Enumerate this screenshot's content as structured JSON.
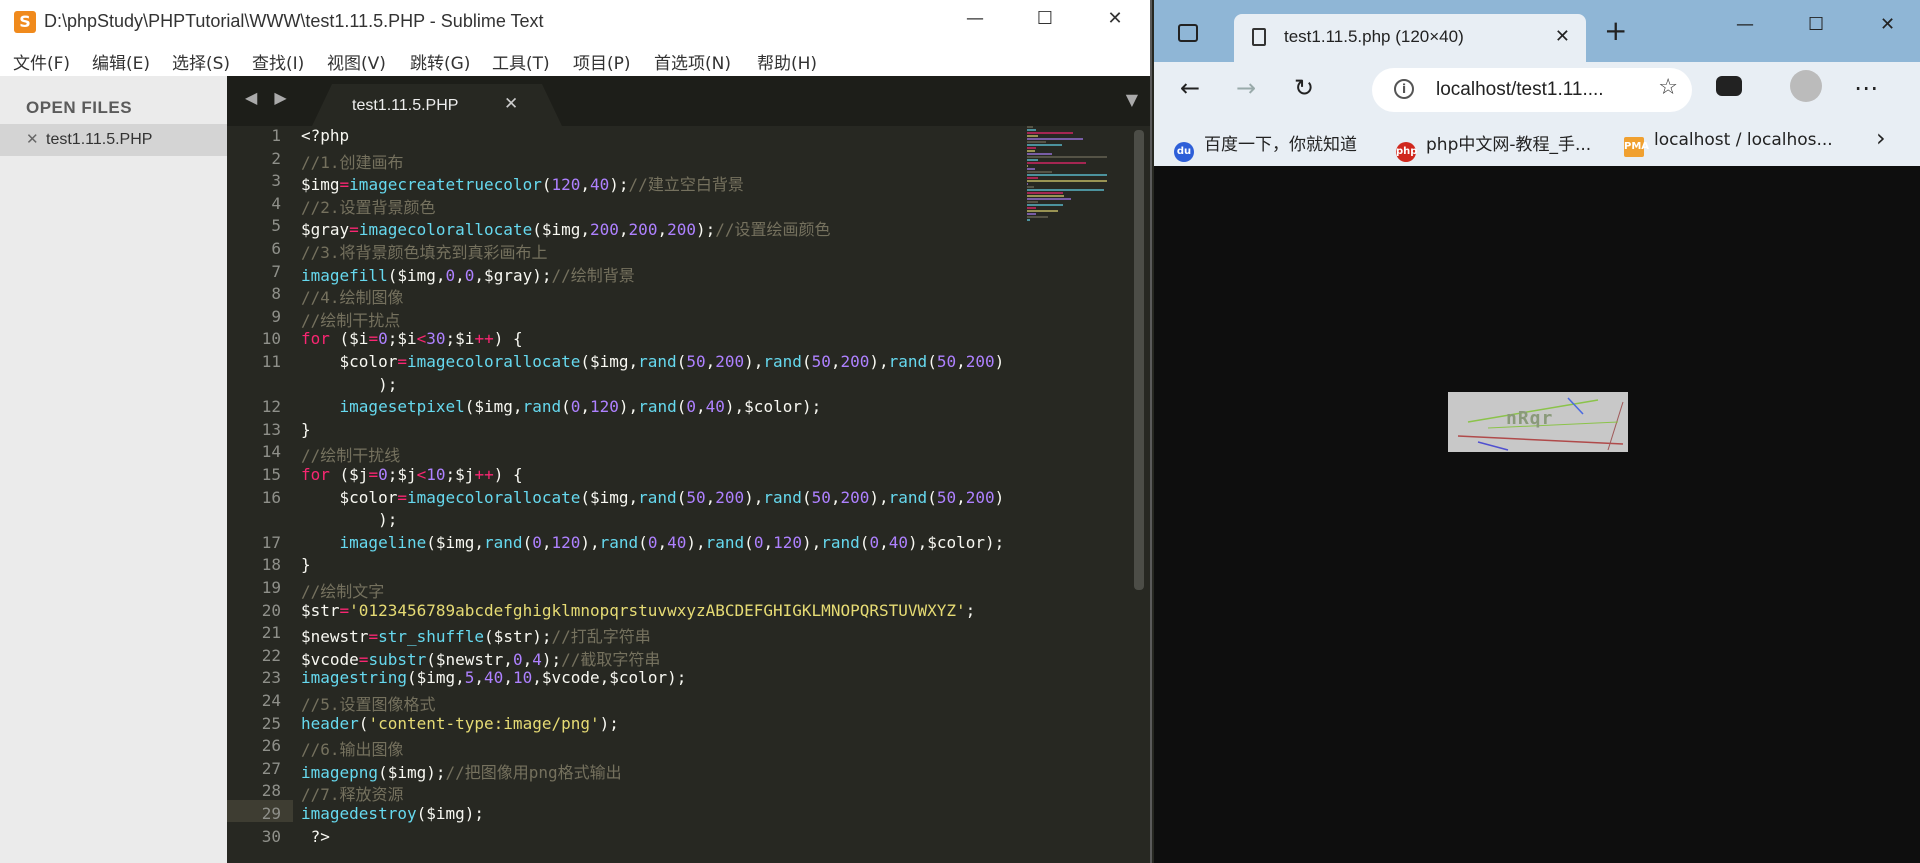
{
  "editor": {
    "title": "D:\\phpStudy\\PHPTutorial\\WWW\\test1.11.5.PHP - Sublime Text",
    "logo_letter": "S",
    "window_buttons": {
      "minimize": "—",
      "maximize": "☐",
      "close": "✕"
    },
    "menu": [
      "文件(F)",
      "编辑(E)",
      "选择(S)",
      "查找(I)",
      "视图(V)",
      "跳转(G)",
      "工具(T)",
      "项目(P)",
      "首选项(N)",
      "帮助(H)"
    ],
    "sidebar": {
      "header": "OPEN FILES",
      "file_close": "✕",
      "file": "test1.11.5.PHP"
    },
    "tab": {
      "arrows": "◀ ▶",
      "name": "test1.11.5.PHP",
      "close": "✕",
      "dropdown": "▼"
    },
    "line_numbers": [
      "1",
      "2",
      "3",
      "4",
      "5",
      "6",
      "7",
      "8",
      "9",
      "10",
      "11",
      "",
      "12",
      "13",
      "14",
      "15",
      "16",
      "",
      "17",
      "18",
      "19",
      "20",
      "21",
      "22",
      "23",
      "24",
      "25",
      "26",
      "27",
      "28",
      "29",
      "30"
    ],
    "code_lines": [
      [
        {
          "t": "<?php",
          "c": ""
        }
      ],
      [
        {
          "t": "//1.创建画布",
          "c": "cm"
        }
      ],
      [
        {
          "t": "$img",
          "c": ""
        },
        {
          "t": "=",
          "c": "op"
        },
        {
          "t": "imagecreatetruecolor",
          "c": "fn"
        },
        {
          "t": "(",
          "c": ""
        },
        {
          "t": "120",
          "c": "num"
        },
        {
          "t": ",",
          "c": ""
        },
        {
          "t": "40",
          "c": "num"
        },
        {
          "t": ");",
          "c": ""
        },
        {
          "t": "//建立空白背景",
          "c": "cm"
        }
      ],
      [
        {
          "t": "//2.设置背景颜色",
          "c": "cm"
        }
      ],
      [
        {
          "t": "$gray",
          "c": ""
        },
        {
          "t": "=",
          "c": "op"
        },
        {
          "t": "imagecolorallocate",
          "c": "fn"
        },
        {
          "t": "($img,",
          "c": ""
        },
        {
          "t": "200",
          "c": "num"
        },
        {
          "t": ",",
          "c": ""
        },
        {
          "t": "200",
          "c": "num"
        },
        {
          "t": ",",
          "c": ""
        },
        {
          "t": "200",
          "c": "num"
        },
        {
          "t": ");",
          "c": ""
        },
        {
          "t": "//设置绘画颜色",
          "c": "cm"
        }
      ],
      [
        {
          "t": "//3.将背景颜色填充到真彩画布上",
          "c": "cm"
        }
      ],
      [
        {
          "t": "imagefill",
          "c": "fn"
        },
        {
          "t": "($img,",
          "c": ""
        },
        {
          "t": "0",
          "c": "num"
        },
        {
          "t": ",",
          "c": ""
        },
        {
          "t": "0",
          "c": "num"
        },
        {
          "t": ",$gray);",
          "c": ""
        },
        {
          "t": "//绘制背景",
          "c": "cm"
        }
      ],
      [
        {
          "t": "//4.绘制图像",
          "c": "cm"
        }
      ],
      [
        {
          "t": "//绘制干扰点",
          "c": "cm"
        }
      ],
      [
        {
          "t": "for",
          "c": "kw"
        },
        {
          "t": " ($i",
          "c": ""
        },
        {
          "t": "=",
          "c": "op"
        },
        {
          "t": "0",
          "c": "num"
        },
        {
          "t": ";$i",
          "c": ""
        },
        {
          "t": "<",
          "c": "op"
        },
        {
          "t": "30",
          "c": "num"
        },
        {
          "t": ";$i",
          "c": ""
        },
        {
          "t": "++",
          "c": "op"
        },
        {
          "t": ") {",
          "c": ""
        }
      ],
      [
        {
          "t": "    $color",
          "c": ""
        },
        {
          "t": "=",
          "c": "op"
        },
        {
          "t": "imagecolorallocate",
          "c": "fn"
        },
        {
          "t": "($img,",
          "c": ""
        },
        {
          "t": "rand",
          "c": "fn"
        },
        {
          "t": "(",
          "c": ""
        },
        {
          "t": "50",
          "c": "num"
        },
        {
          "t": ",",
          "c": ""
        },
        {
          "t": "200",
          "c": "num"
        },
        {
          "t": "),",
          "c": ""
        },
        {
          "t": "rand",
          "c": "fn"
        },
        {
          "t": "(",
          "c": ""
        },
        {
          "t": "50",
          "c": "num"
        },
        {
          "t": ",",
          "c": ""
        },
        {
          "t": "200",
          "c": "num"
        },
        {
          "t": "),",
          "c": ""
        },
        {
          "t": "rand",
          "c": "fn"
        },
        {
          "t": "(",
          "c": ""
        },
        {
          "t": "50",
          "c": "num"
        },
        {
          "t": ",",
          "c": ""
        },
        {
          "t": "200",
          "c": "num"
        },
        {
          "t": ")",
          "c": ""
        }
      ],
      [
        {
          "t": "        );",
          "c": ""
        }
      ],
      [
        {
          "t": "    ",
          "c": ""
        },
        {
          "t": "imagesetpixel",
          "c": "fn"
        },
        {
          "t": "($img,",
          "c": ""
        },
        {
          "t": "rand",
          "c": "fn"
        },
        {
          "t": "(",
          "c": ""
        },
        {
          "t": "0",
          "c": "num"
        },
        {
          "t": ",",
          "c": ""
        },
        {
          "t": "120",
          "c": "num"
        },
        {
          "t": "),",
          "c": ""
        },
        {
          "t": "rand",
          "c": "fn"
        },
        {
          "t": "(",
          "c": ""
        },
        {
          "t": "0",
          "c": "num"
        },
        {
          "t": ",",
          "c": ""
        },
        {
          "t": "40",
          "c": "num"
        },
        {
          "t": "),$color);",
          "c": ""
        }
      ],
      [
        {
          "t": "}",
          "c": ""
        }
      ],
      [
        {
          "t": "//绘制干扰线",
          "c": "cm"
        }
      ],
      [
        {
          "t": "for",
          "c": "kw"
        },
        {
          "t": " ($j",
          "c": ""
        },
        {
          "t": "=",
          "c": "op"
        },
        {
          "t": "0",
          "c": "num"
        },
        {
          "t": ";$j",
          "c": ""
        },
        {
          "t": "<",
          "c": "op"
        },
        {
          "t": "10",
          "c": "num"
        },
        {
          "t": ";$j",
          "c": ""
        },
        {
          "t": "++",
          "c": "op"
        },
        {
          "t": ") {",
          "c": ""
        }
      ],
      [
        {
          "t": "    $color",
          "c": ""
        },
        {
          "t": "=",
          "c": "op"
        },
        {
          "t": "imagecolorallocate",
          "c": "fn"
        },
        {
          "t": "($img,",
          "c": ""
        },
        {
          "t": "rand",
          "c": "fn"
        },
        {
          "t": "(",
          "c": ""
        },
        {
          "t": "50",
          "c": "num"
        },
        {
          "t": ",",
          "c": ""
        },
        {
          "t": "200",
          "c": "num"
        },
        {
          "t": "),",
          "c": ""
        },
        {
          "t": "rand",
          "c": "fn"
        },
        {
          "t": "(",
          "c": ""
        },
        {
          "t": "50",
          "c": "num"
        },
        {
          "t": ",",
          "c": ""
        },
        {
          "t": "200",
          "c": "num"
        },
        {
          "t": "),",
          "c": ""
        },
        {
          "t": "rand",
          "c": "fn"
        },
        {
          "t": "(",
          "c": ""
        },
        {
          "t": "50",
          "c": "num"
        },
        {
          "t": ",",
          "c": ""
        },
        {
          "t": "200",
          "c": "num"
        },
        {
          "t": ")",
          "c": ""
        }
      ],
      [
        {
          "t": "        );",
          "c": ""
        }
      ],
      [
        {
          "t": "    ",
          "c": ""
        },
        {
          "t": "imageline",
          "c": "fn"
        },
        {
          "t": "($img,",
          "c": ""
        },
        {
          "t": "rand",
          "c": "fn"
        },
        {
          "t": "(",
          "c": ""
        },
        {
          "t": "0",
          "c": "num"
        },
        {
          "t": ",",
          "c": ""
        },
        {
          "t": "120",
          "c": "num"
        },
        {
          "t": "),",
          "c": ""
        },
        {
          "t": "rand",
          "c": "fn"
        },
        {
          "t": "(",
          "c": ""
        },
        {
          "t": "0",
          "c": "num"
        },
        {
          "t": ",",
          "c": ""
        },
        {
          "t": "40",
          "c": "num"
        },
        {
          "t": "),",
          "c": ""
        },
        {
          "t": "rand",
          "c": "fn"
        },
        {
          "t": "(",
          "c": ""
        },
        {
          "t": "0",
          "c": "num"
        },
        {
          "t": ",",
          "c": ""
        },
        {
          "t": "120",
          "c": "num"
        },
        {
          "t": "),",
          "c": ""
        },
        {
          "t": "rand",
          "c": "fn"
        },
        {
          "t": "(",
          "c": ""
        },
        {
          "t": "0",
          "c": "num"
        },
        {
          "t": ",",
          "c": ""
        },
        {
          "t": "40",
          "c": "num"
        },
        {
          "t": "),$color);",
          "c": ""
        }
      ],
      [
        {
          "t": "}",
          "c": ""
        }
      ],
      [
        {
          "t": "//绘制文字",
          "c": "cm"
        }
      ],
      [
        {
          "t": "$str",
          "c": ""
        },
        {
          "t": "=",
          "c": "op"
        },
        {
          "t": "'0123456789abcdefghigklmnopqrstuvwxyzABCDEFGHIGKLMNOPQRSTUVWXYZ'",
          "c": "str"
        },
        {
          "t": ";",
          "c": ""
        }
      ],
      [
        {
          "t": "$newstr",
          "c": ""
        },
        {
          "t": "=",
          "c": "op"
        },
        {
          "t": "str_shuffle",
          "c": "fn"
        },
        {
          "t": "($str);",
          "c": ""
        },
        {
          "t": "//打乱字符串",
          "c": "cm"
        }
      ],
      [
        {
          "t": "$vcode",
          "c": ""
        },
        {
          "t": "=",
          "c": "op"
        },
        {
          "t": "substr",
          "c": "fn"
        },
        {
          "t": "($newstr,",
          "c": ""
        },
        {
          "t": "0",
          "c": "num"
        },
        {
          "t": ",",
          "c": ""
        },
        {
          "t": "4",
          "c": "num"
        },
        {
          "t": ");",
          "c": ""
        },
        {
          "t": "//截取字符串",
          "c": "cm"
        }
      ],
      [
        {
          "t": "imagestring",
          "c": "fn"
        },
        {
          "t": "($img,",
          "c": ""
        },
        {
          "t": "5",
          "c": "num"
        },
        {
          "t": ",",
          "c": ""
        },
        {
          "t": "40",
          "c": "num"
        },
        {
          "t": ",",
          "c": ""
        },
        {
          "t": "10",
          "c": "num"
        },
        {
          "t": ",$vcode,$color);",
          "c": ""
        }
      ],
      [
        {
          "t": "//5.设置图像格式",
          "c": "cm"
        }
      ],
      [
        {
          "t": "header",
          "c": "fn"
        },
        {
          "t": "(",
          "c": ""
        },
        {
          "t": "'content-type:image/png'",
          "c": "str"
        },
        {
          "t": ");",
          "c": ""
        }
      ],
      [
        {
          "t": "//6.输出图像",
          "c": "cm"
        }
      ],
      [
        {
          "t": "imagepng",
          "c": "fn"
        },
        {
          "t": "($img);",
          "c": ""
        },
        {
          "t": "//把图像用png格式输出",
          "c": "cm"
        }
      ],
      [
        {
          "t": "//7.释放资源",
          "c": "cm"
        }
      ],
      [
        {
          "t": "imagedestroy",
          "c": "fn"
        },
        {
          "t": "($img);",
          "c": ""
        }
      ],
      [
        {
          "t": " ?>",
          "c": ""
        }
      ]
    ]
  },
  "browser": {
    "tab_title": "test1.11.5.php (120×40)",
    "tab_close": "✕",
    "new_tab": "+",
    "window_buttons": {
      "minimize": "—",
      "maximize": "☐",
      "close": "✕"
    },
    "nav": {
      "back": "←",
      "forward": "→",
      "refresh": "↻",
      "more": "⋯"
    },
    "address": {
      "info": "i",
      "url": "localhost/test1.11....",
      "favorite": "☆"
    },
    "bookmarks": [
      {
        "label": "百度一下，你就知道",
        "icon": "du",
        "color": "#2e5fd8"
      },
      {
        "label": "php中文网-教程_手...",
        "icon": "php",
        "color": "#d0281e"
      },
      {
        "label": "localhost / localhos...",
        "icon": "PMA",
        "color": "#f0a030"
      }
    ],
    "bookmarks_more": "›",
    "captcha_text": "nRqr"
  }
}
